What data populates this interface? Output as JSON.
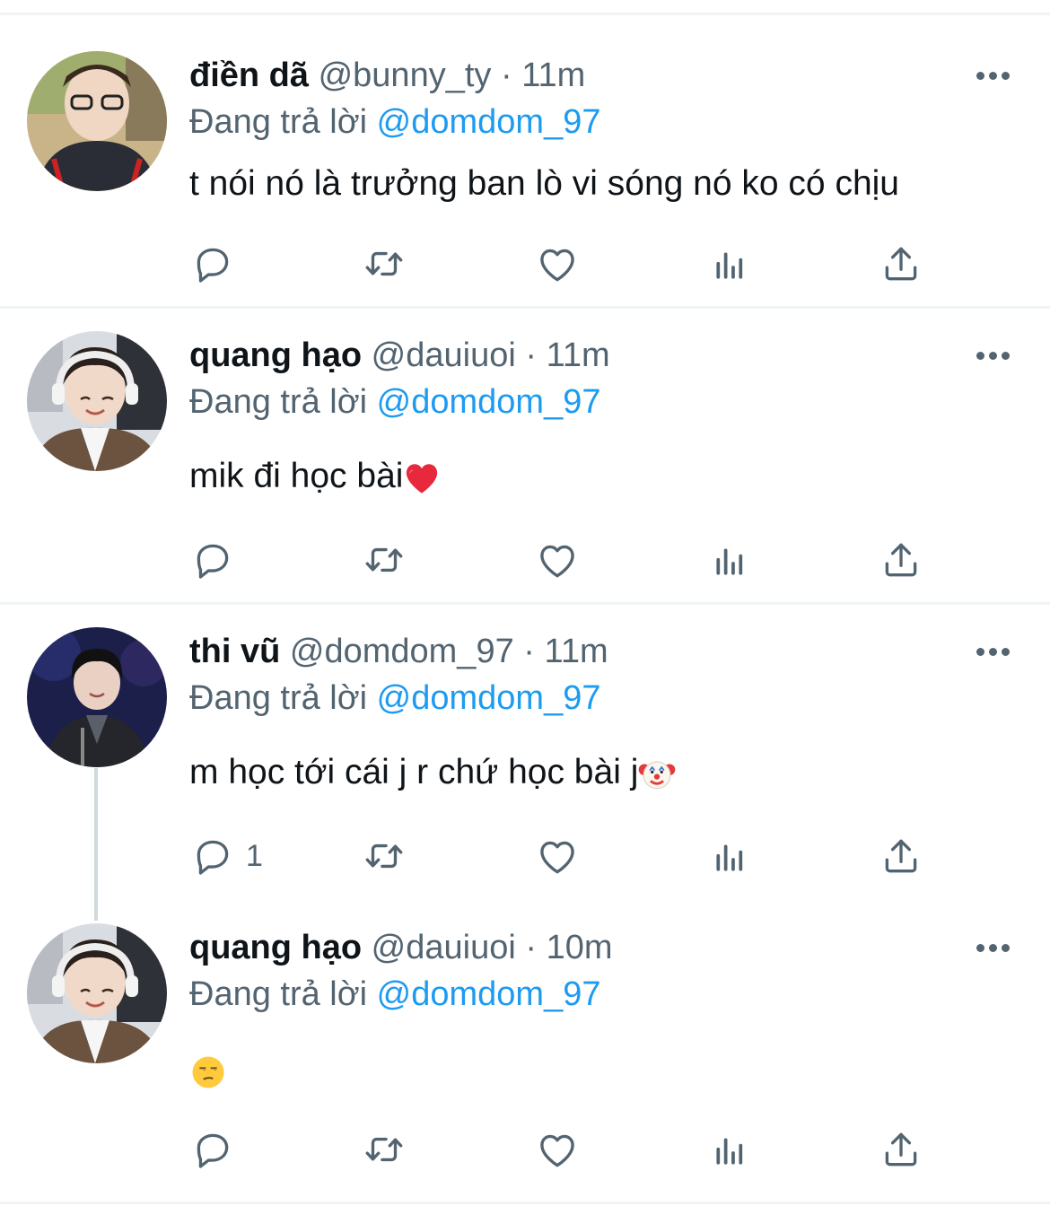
{
  "colors": {
    "accent": "#1d9bf0",
    "secondary_text": "#536471",
    "primary_text": "#0f1419",
    "divider": "#eff3f4"
  },
  "tweets": [
    {
      "name": "điền dã",
      "handle": "@bunny_ty",
      "time": "11m",
      "replying_prefix": "Đang trả lời",
      "replying_to": "@domdom_97",
      "text": "t nói nó là trưởng ban lò vi sóng nó ko có chịu",
      "text_emoji": "",
      "reply_count": "",
      "icons": [
        "reply-icon",
        "retweet-icon",
        "like-icon",
        "views-icon",
        "share-icon"
      ]
    },
    {
      "name": "quang hạo",
      "handle": "@dauiuoi",
      "time": "11m",
      "replying_prefix": "Đang trả lời",
      "replying_to": "@domdom_97",
      "text": "mik đi học bài",
      "text_emoji": "red-heart",
      "reply_count": "",
      "icons": [
        "reply-icon",
        "retweet-icon",
        "like-icon",
        "views-icon",
        "share-icon"
      ]
    },
    {
      "name": "thi vũ",
      "handle": "@domdom_97",
      "time": "11m",
      "replying_prefix": "Đang trả lời",
      "replying_to": "@domdom_97",
      "text": "m học tới cái j r chứ học bài j",
      "text_emoji": "clown-face",
      "reply_count": "1",
      "icons": [
        "reply-icon",
        "retweet-icon",
        "like-icon",
        "views-icon",
        "share-icon"
      ]
    },
    {
      "name": "quang hạo",
      "handle": "@dauiuoi",
      "time": "10m",
      "replying_prefix": "Đang trả lời",
      "replying_to": "@domdom_97",
      "text": "",
      "text_emoji": "unamused-face",
      "reply_count": "",
      "icons": [
        "reply-icon",
        "retweet-icon",
        "like-icon",
        "views-icon",
        "share-icon"
      ]
    }
  ]
}
